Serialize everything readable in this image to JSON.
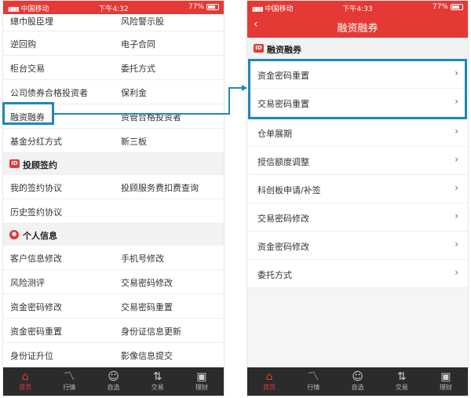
{
  "left": {
    "status": {
      "carrier": "中国移动",
      "time": "下午4:32",
      "battery": "77%"
    },
    "rows": [
      {
        "c1": "總巾股臣埋",
        "c2": "风险警示股"
      },
      {
        "c1": "逆回购",
        "c2": "电子合同"
      },
      {
        "c1": "柜台交易",
        "c2": "委托方式"
      },
      {
        "c1": "公司债券合格投资者",
        "c2": "保利金"
      },
      {
        "c1": "融资融券",
        "c2": "资管合格投资者"
      },
      {
        "c1": "基金分红方式",
        "c2": "新三板"
      }
    ],
    "section_sign": {
      "label": "投顾签约"
    },
    "sign_rows": [
      {
        "c1": "我的签约协议",
        "c2": "投顾服务费扣费查询"
      },
      {
        "c1": "历史签约协议",
        "c2": ""
      }
    ],
    "section_personal": {
      "label": "个人信息"
    },
    "personal_rows": [
      {
        "c1": "客户信息修改",
        "c2": "手机号修改"
      },
      {
        "c1": "风险测评",
        "c2": "交易密码修改"
      },
      {
        "c1": "资金密码修改",
        "c2": "交易密码重置"
      },
      {
        "c1": "资金密码重置",
        "c2": "身份证信息更新"
      },
      {
        "c1": "身份证升位",
        "c2": "影像信息提交"
      }
    ]
  },
  "right": {
    "status": {
      "carrier": "中国移动",
      "time": "下午4:33",
      "battery": "77%"
    },
    "nav_title": "融资融券",
    "back_symbol": "‹",
    "section": {
      "label": "融资融券"
    },
    "rows": [
      "资金密码重置",
      "交易密码重置",
      "仓单展期",
      "授信额度调整",
      "科创板申请/补签",
      "交易密码修改",
      "资金密码修改",
      "委托方式"
    ]
  },
  "tabs": [
    {
      "label": "首页",
      "icon": "home-icon"
    },
    {
      "label": "行情",
      "icon": "chart-line-icon"
    },
    {
      "label": "自选",
      "icon": "user-icon"
    },
    {
      "label": "交易",
      "icon": "trade-icon"
    },
    {
      "label": "理财",
      "icon": "shop-icon"
    }
  ],
  "colors": {
    "accent": "#e53935",
    "highlight": "#1e88b5",
    "tabbar": "#2b2b2b"
  }
}
